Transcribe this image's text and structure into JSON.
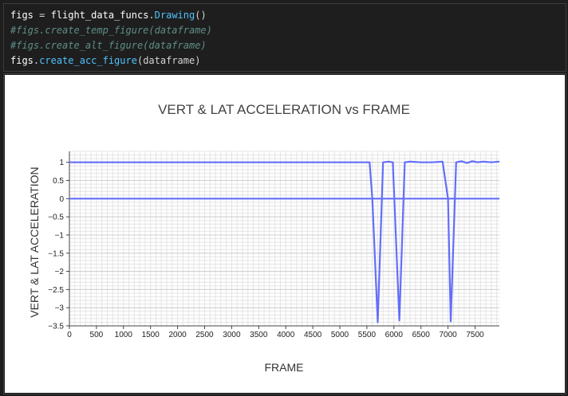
{
  "code_cell": {
    "lines": [
      [
        {
          "text": "figs",
          "cls": "tok-var"
        },
        {
          "text": " = ",
          "cls": "tok-op"
        },
        {
          "text": "flight_data_funcs",
          "cls": "tok-var"
        },
        {
          "text": ".",
          "cls": "tok-op"
        },
        {
          "text": "Drawing",
          "cls": "tok-call"
        },
        {
          "text": "()",
          "cls": "tok-op"
        }
      ],
      [
        {
          "text": "#figs.create_temp_figure(dataframe)",
          "cls": "tok-comment"
        }
      ],
      [
        {
          "text": "#figs.create_alt_figure(dataframe)",
          "cls": "tok-comment"
        }
      ],
      [
        {
          "text": "figs",
          "cls": "tok-var"
        },
        {
          "text": ".",
          "cls": "tok-op"
        },
        {
          "text": "create_acc_figure",
          "cls": "tok-call"
        },
        {
          "text": "(dataframe)",
          "cls": "tok-op"
        }
      ]
    ]
  },
  "chart_data": {
    "type": "line",
    "title": "VERT & LAT ACCELERATION vs FRAME",
    "xlabel": "FRAME",
    "ylabel": "VERT & LAT ACCELERATION",
    "xlim": [
      0,
      7950
    ],
    "ylim": [
      -3.5,
      1.3
    ],
    "xticks": [
      0,
      500,
      1000,
      1500,
      2000,
      2500,
      3000,
      3500,
      4000,
      4500,
      5000,
      5500,
      6000,
      6500,
      7000,
      7500
    ],
    "yticks": [
      1,
      0.5,
      0,
      -0.5,
      -1,
      -1.5,
      -2,
      -2.5,
      -3,
      -3.5
    ],
    "ytick_labels": [
      "1",
      "0.5",
      "0",
      "−0.5",
      "−1",
      "−1.5",
      "−2",
      "−2.5",
      "−3",
      "−3.5"
    ],
    "grid": true,
    "line_color": "#636efa",
    "series": [
      {
        "x": [
          0,
          5550,
          5600,
          5700,
          5800,
          5900,
          5980,
          6100,
          6200,
          6300,
          6500,
          6700,
          6900,
          7000,
          7050,
          7150,
          7250,
          7350,
          7450,
          7550,
          7650,
          7800,
          7950
        ],
        "values": [
          1.0,
          1.0,
          0.0,
          -3.4,
          1.0,
          1.02,
          1.0,
          -3.35,
          1.0,
          1.02,
          1.0,
          1.0,
          1.02,
          0.0,
          -3.38,
          1.0,
          1.03,
          0.98,
          1.03,
          1.0,
          1.02,
          1.0,
          1.02
        ]
      },
      {
        "x": [
          0,
          7950
        ],
        "values": [
          0,
          0
        ]
      }
    ]
  }
}
